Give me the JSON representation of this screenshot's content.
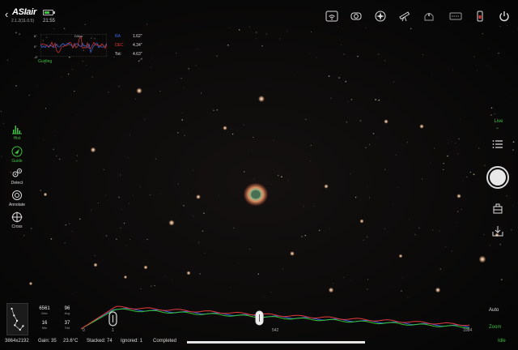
{
  "app": {
    "logo": "ASIair",
    "version": "2.1.2(11.0.5)",
    "clock": "21:55",
    "back_icon": "chevron-left-icon"
  },
  "top_icons": [
    "wifi-icon",
    "camera-icon",
    "focuser-icon",
    "telescope-icon",
    "observatory-icon",
    "settings-panel-icon",
    "filter-wheel-icon",
    "power-icon"
  ],
  "guide": {
    "title": "Dither",
    "y_ticks": [
      "8\"",
      "0\"",
      "-8\""
    ],
    "ra_label": "RA",
    "ra_value": "1.62\"",
    "dec_label": "DEC",
    "dec_value": "4.34\"",
    "tot_label": "Tot:",
    "tot_value": "4.63\"",
    "status": "Guiding",
    "expand_icon": "expand-icon",
    "colors": {
      "ra": "#3b6ee8",
      "dec": "#e03535"
    }
  },
  "left_tools": [
    {
      "label": "Hist",
      "icon": "histogram-icon",
      "active": true
    },
    {
      "label": "Guide",
      "icon": "guide-icon",
      "active": true
    },
    {
      "label": "Detect",
      "icon": "detect-icon",
      "active": false
    },
    {
      "label": "Annotate",
      "icon": "annotate-icon",
      "active": false
    },
    {
      "label": "Cross",
      "icon": "crosshair-icon",
      "active": false
    }
  ],
  "right": {
    "mode": "Live",
    "list_icon": "list-icon",
    "shutter_icon": "shutter-icon",
    "stack_icon": "stack-icon",
    "save_icon": "save-icon"
  },
  "stats": [
    {
      "value": "6561",
      "key": "Max"
    },
    {
      "value": "96",
      "key": "Avg"
    },
    {
      "value": "16",
      "key": "Min"
    },
    {
      "value": "37",
      "key": "Std"
    }
  ],
  "histogram": {
    "left_num": "0",
    "left_handle": "1",
    "mid_handle": "542",
    "right_num": "1084",
    "colors": {
      "red": "#e23a3a",
      "green": "#34c234",
      "blue": "#3a5fe6"
    }
  },
  "auto_label": "Auto",
  "zoom_label": "Zoom",
  "idle_label": "Idle",
  "status": {
    "resolution": "3864x2192",
    "gain": "Gain: 35",
    "temp": "23.6°C",
    "stacked": "Stacked: 74",
    "ignored": "Ignored: 1",
    "state": "Completed",
    "progress": 1.0
  }
}
